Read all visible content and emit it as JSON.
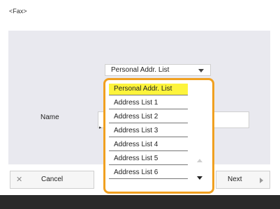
{
  "header": {
    "title": "<Fax>"
  },
  "form": {
    "dropdown_selected": "Personal Addr. List",
    "name_label": "Name"
  },
  "dropdown": {
    "options": [
      "Personal Addr. List",
      "Address List 1",
      "Address List 2",
      "Address List 3",
      "Address List 4",
      "Address List 5",
      "Address List 6"
    ],
    "selected_index": 0
  },
  "footer": {
    "cancel_label": "Cancel",
    "next_label": "Next"
  },
  "icons": {
    "cancel": "close-icon",
    "next": "chevron-right-icon",
    "dropdown": "chevron-down-icon",
    "scroll_up": "scroll-up-icon",
    "scroll_down": "scroll-down-icon"
  },
  "colors": {
    "highlight": "#fdf43c",
    "dropdown_border": "#f0a020",
    "panel": "#e9e9ef",
    "footer_bar": "#2a2a2a"
  }
}
